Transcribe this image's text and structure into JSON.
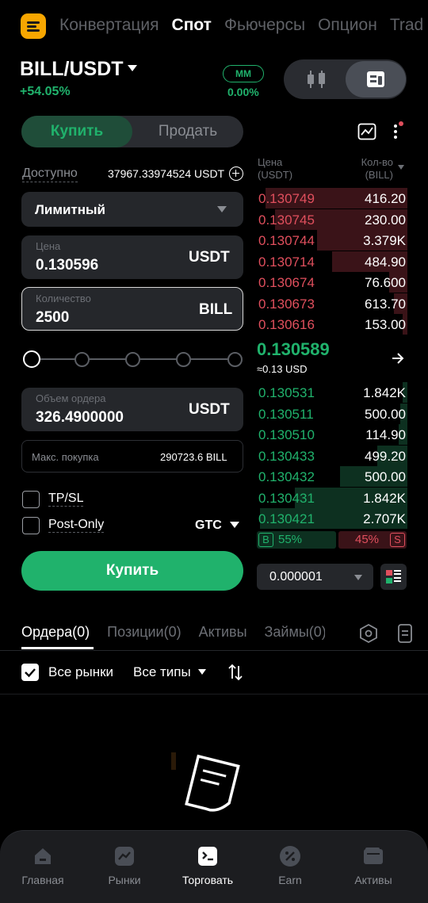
{
  "topnav": {
    "tabs": [
      "Конвертация",
      "Спот",
      "Фьючерсы",
      "Опцион",
      "Trad"
    ],
    "active": "Спот"
  },
  "ticker": {
    "pair": "BILL/USDT",
    "change": "+54.05%",
    "mm_label": "MM",
    "mm_value": "0.00%"
  },
  "trade": {
    "buy_tab": "Купить",
    "sell_tab": "Продать",
    "available_label": "Доступно",
    "available_value": "37967.33974524 USDT",
    "order_type": "Лимитный",
    "price_label": "Цена",
    "price_value": "0.130596",
    "price_unit": "USDT",
    "qty_label": "Количество",
    "qty_value": "2500",
    "qty_unit": "BILL",
    "slider_value_percent": 0,
    "volume_label": "Объем ордера",
    "volume_value": "326.4900000",
    "volume_unit": "USDT",
    "maxbuy_label": "Макс. покупка",
    "maxbuy_value": "290723.6 BILL",
    "tpsl_label": "TP/SL",
    "postonly_label": "Post-Only",
    "tif": "GTC",
    "submit_label": "Купить"
  },
  "orderbook": {
    "price_header": "Цена\n(USDT)",
    "price_header_1": "Цена",
    "price_header_2": "(USDT)",
    "qty_header_1": "Кол-во",
    "qty_header_2": "(BILL)",
    "asks": [
      {
        "price": "0.130749",
        "qty": "416.20",
        "depth": 0.94
      },
      {
        "price": "0.130745",
        "qty": "230.00",
        "depth": 0.88
      },
      {
        "price": "0.130744",
        "qty": "3.379K",
        "depth": 0.6
      },
      {
        "price": "0.130714",
        "qty": "484.90",
        "depth": 0.5
      },
      {
        "price": "0.130674",
        "qty": "76.600",
        "depth": 0.12
      },
      {
        "price": "0.130673",
        "qty": "613.70",
        "depth": 0.09
      },
      {
        "price": "0.130616",
        "qty": "153.00",
        "depth": 0.03
      }
    ],
    "last_price": "0.130589",
    "last_usd": "≈0.13 USD",
    "bids": [
      {
        "price": "0.130531",
        "qty": "1.842K",
        "depth": 0.03
      },
      {
        "price": "0.130511",
        "qty": "500.00",
        "depth": 0.05
      },
      {
        "price": "0.130510",
        "qty": "114.90",
        "depth": 0.06
      },
      {
        "price": "0.130433",
        "qty": "499.20",
        "depth": 0.2
      },
      {
        "price": "0.130432",
        "qty": "500.00",
        "depth": 0.45
      },
      {
        "price": "0.130431",
        "qty": "1.842K",
        "depth": 0.75
      },
      {
        "price": "0.130421",
        "qty": "2.707K",
        "depth": 0.98
      }
    ],
    "buy_label": "B",
    "buy_pct": "55%",
    "sell_pct": "45%",
    "sell_label": "S",
    "precision": "0.000001"
  },
  "orders": {
    "tabs": [
      "Ордера(0)",
      "Позиции(0)",
      "Активы",
      "Займы(0)"
    ],
    "all_markets": "Все рынки",
    "all_types": "Все типы"
  },
  "bottom_nav": [
    {
      "label": "Главная",
      "icon": "home-icon"
    },
    {
      "label": "Рынки",
      "icon": "chart-icon"
    },
    {
      "label": "Торговать",
      "icon": "trade-icon"
    },
    {
      "label": "Earn",
      "icon": "percent-icon"
    },
    {
      "label": "Активы",
      "icon": "wallet-icon"
    }
  ],
  "colors": {
    "green": "#20b26c",
    "red": "#e04f5d",
    "brand": "#f7a600",
    "background": "#000000"
  }
}
